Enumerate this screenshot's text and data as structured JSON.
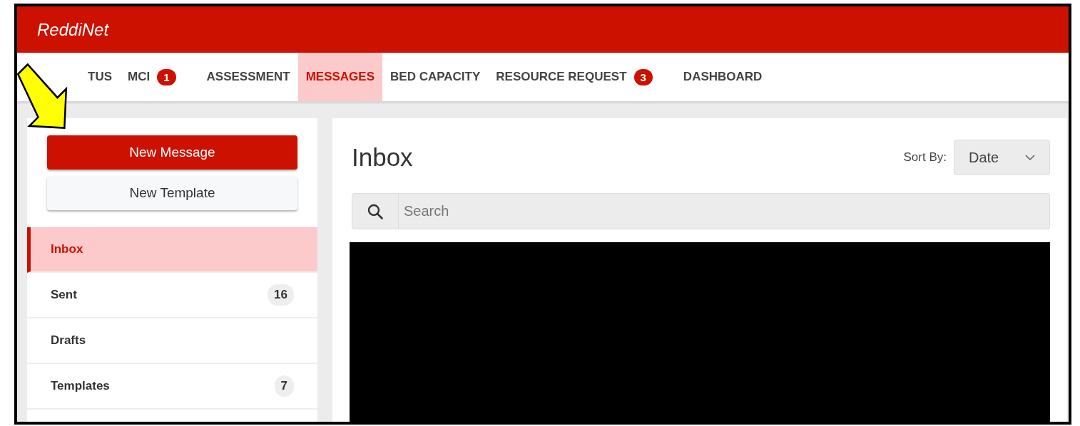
{
  "app": {
    "title": "ReddiNet"
  },
  "nav": [
    {
      "label": "TUS",
      "selected": false
    },
    {
      "label": "MCI",
      "badge": "1",
      "selected": false
    },
    {
      "label": "ASSESSMENT",
      "selected": false
    },
    {
      "label": "MESSAGES",
      "selected": true
    },
    {
      "label": "BED CAPACITY",
      "selected": false
    },
    {
      "label": "RESOURCE REQUEST",
      "badge": "3",
      "selected": false
    },
    {
      "label": "DASHBOARD",
      "selected": false
    }
  ],
  "sidebar": {
    "buttons": [
      {
        "label": "New Message",
        "kind": "primary"
      },
      {
        "label": "New Template",
        "kind": "secondary"
      }
    ],
    "items": [
      {
        "label": "Inbox",
        "selected": true
      },
      {
        "label": "Sent",
        "count": "16",
        "selected": false
      },
      {
        "label": "Drafts",
        "selected": false
      },
      {
        "label": "Templates",
        "count": "7",
        "selected": false
      }
    ]
  },
  "main": {
    "title": "Inbox",
    "sort": {
      "label": "Sort By:",
      "value": "Date"
    },
    "search": {
      "placeholder": "Search"
    }
  }
}
